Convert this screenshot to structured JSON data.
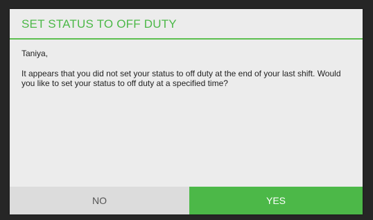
{
  "dialog": {
    "title": "SET STATUS TO OFF DUTY",
    "greeting": "Taniya,",
    "message": "It appears that you did not set your status to off duty at the end of your last shift. Would you like to set your status to off duty at a specified time?"
  },
  "buttons": {
    "no_label": "NO",
    "yes_label": "YES"
  },
  "colors": {
    "accent": "#4cb848",
    "dialog_background": "#ececec",
    "no_button_background": "#dcdcdc",
    "screen_background": "#262626"
  }
}
